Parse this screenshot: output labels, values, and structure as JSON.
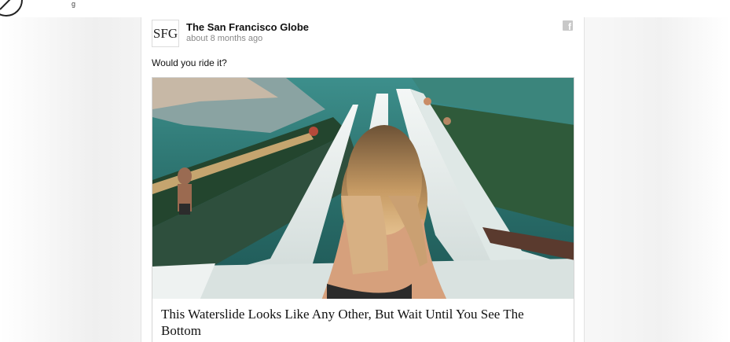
{
  "post": {
    "page_name": "The San Francisco Globe",
    "avatar_text": "SFG",
    "time": "about 8 months ago",
    "message": "Would you ride it?",
    "link_title": "This Waterslide Looks Like Any Other, But Wait Until You See The Bottom",
    "share_icon": "facebook-icon"
  },
  "corner": {
    "logo_icon": "logo-icon",
    "mark": "g"
  },
  "colors": {
    "background": "#f4f4f4",
    "card": "#ffffff",
    "name_text": "#111111",
    "time_text": "#888888",
    "facebook_icon": "#c8c8c8",
    "pool_water": "#2f7a78",
    "slide_white": "#e6ecec"
  }
}
